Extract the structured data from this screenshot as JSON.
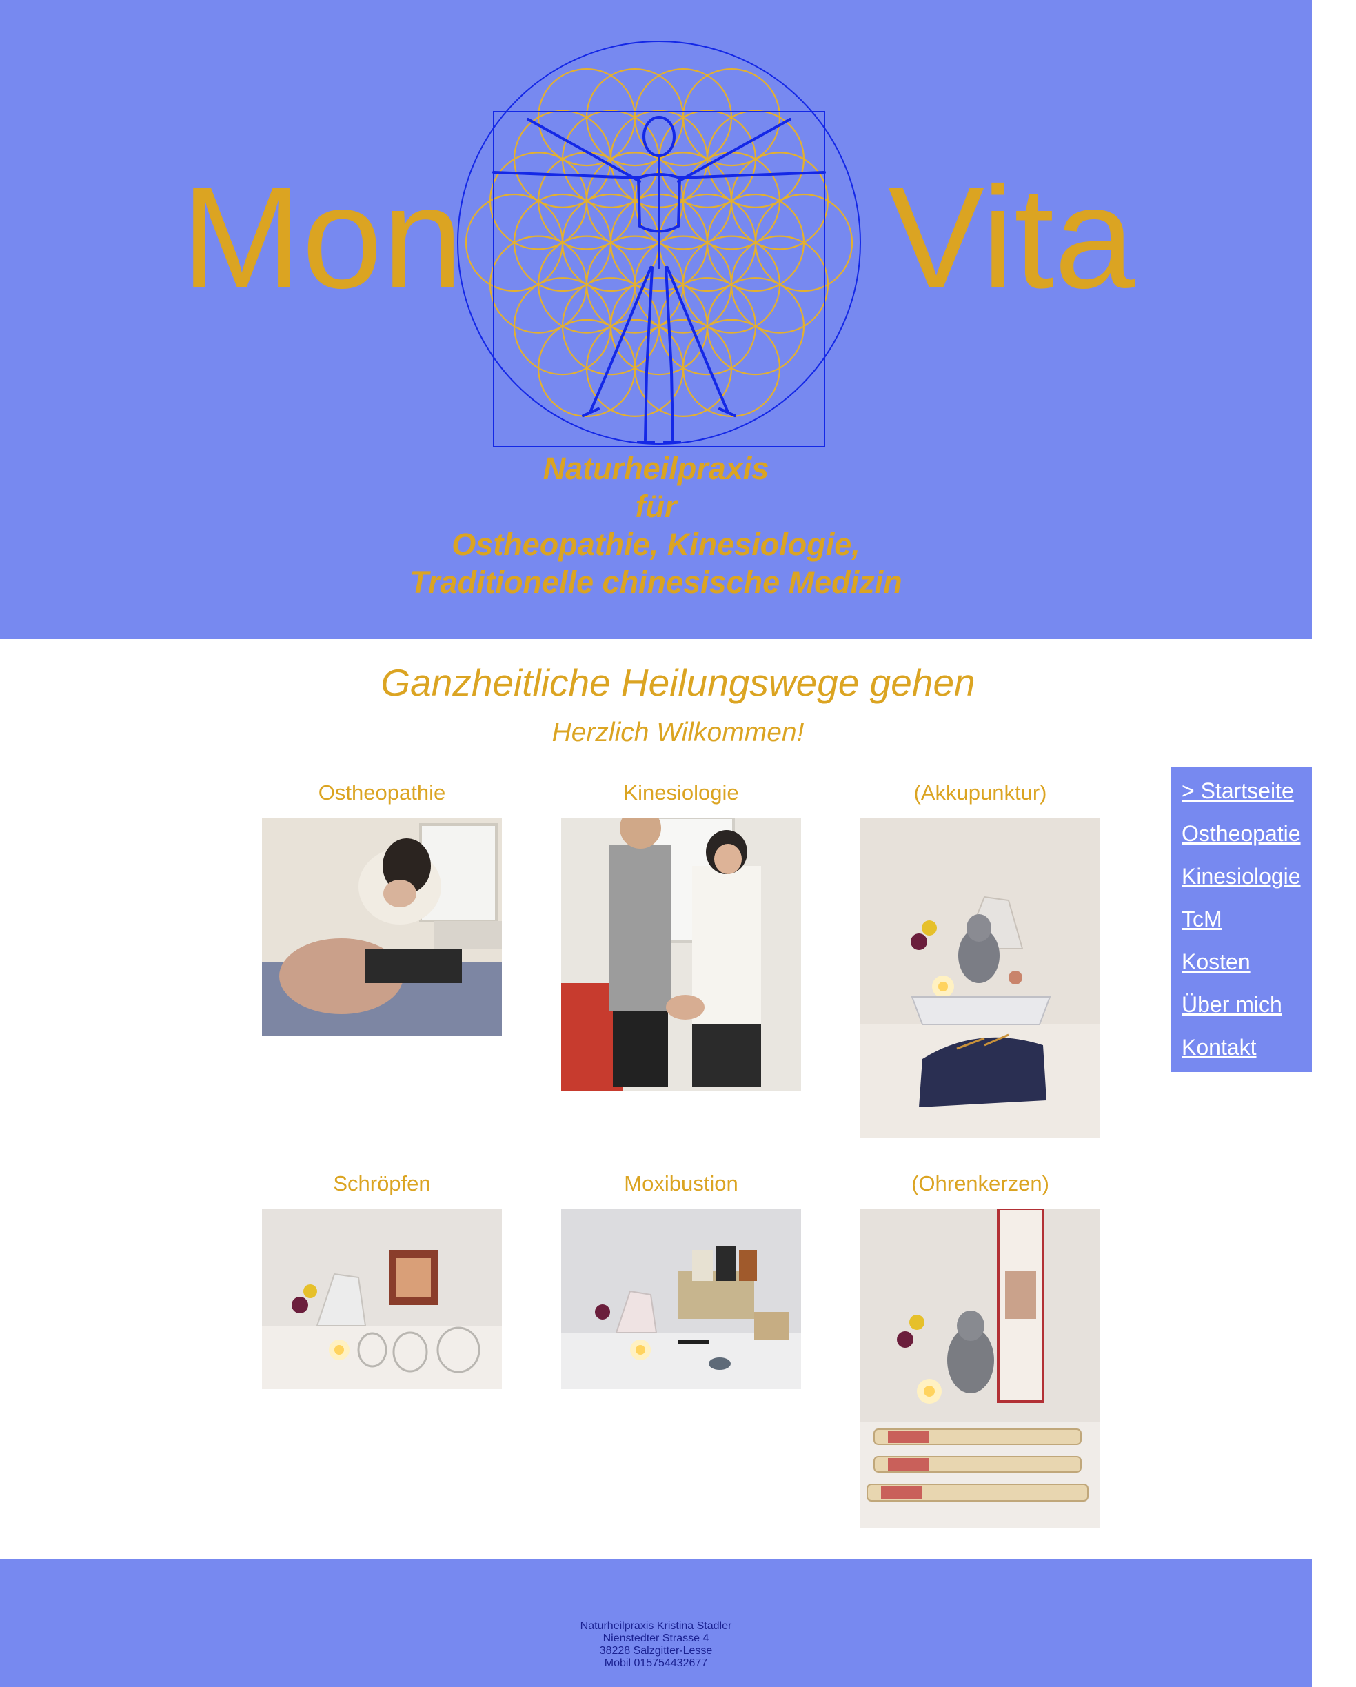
{
  "header": {
    "brand_left": "Mon",
    "brand_right": "Vita",
    "tagline": [
      "Naturheilpraxis",
      "für",
      "Ostheopathie, Kinesiologie,",
      "Traditionelle chinesische Medizin"
    ]
  },
  "main": {
    "heading": "Ganzheitliche Heilungswege gehen",
    "subheading": "Herzlich Wilkommen!",
    "services": [
      {
        "title": "Ostheopathie"
      },
      {
        "title": "Kinesiologie"
      },
      {
        "title": "(Akkupunktur)"
      },
      {
        "title": "Schröpfen"
      },
      {
        "title": "Moxibustion"
      },
      {
        "title": "(Ohrenkerzen)"
      }
    ]
  },
  "nav": {
    "items": [
      {
        "label": "> Startseite"
      },
      {
        "label": "Ostheopatie"
      },
      {
        "label": "Kinesiologie"
      },
      {
        "label": "TcM"
      },
      {
        "label": "Kosten"
      },
      {
        "label": "Über mich"
      },
      {
        "label": "Kontakt"
      }
    ]
  },
  "footer": {
    "lines": [
      "Naturheilpraxis Kristina Stadler",
      "Nienstedter Strasse 4",
      "38228 Salzgitter-Lesse",
      "Mobil 015754432677"
    ]
  },
  "colors": {
    "brand_blue": "#7789f0",
    "gold": "#dba422",
    "footer_text": "#1a2191",
    "logo_line": "#1428e6"
  }
}
